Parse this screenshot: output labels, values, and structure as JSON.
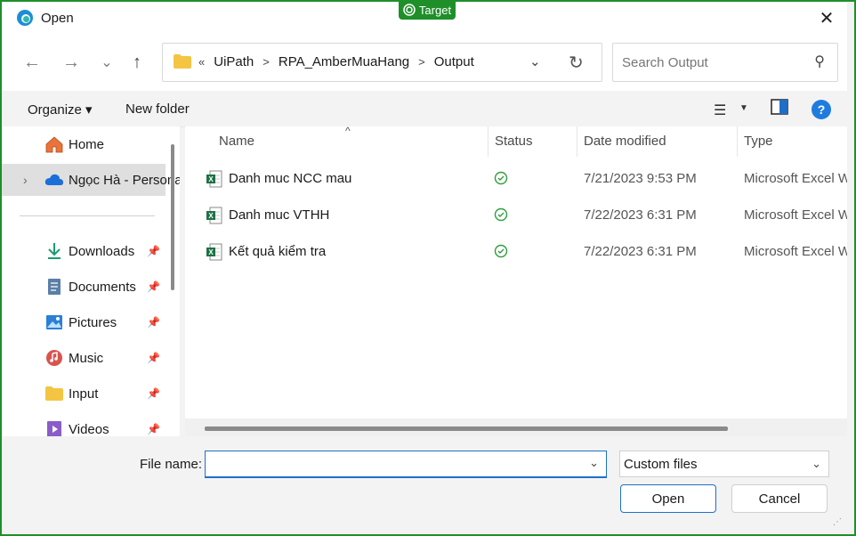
{
  "badge": {
    "label": "Target",
    "icon": "target-icon"
  },
  "window": {
    "title": "Open",
    "close_glyph": "✕"
  },
  "nav": {
    "back_glyph": "←",
    "forward_glyph": "→",
    "recent_glyph": "⌄",
    "up_glyph": "↑",
    "crumbs_prefix": "«",
    "crumbs": [
      "UiPath",
      "RPA_AmberMuaHang",
      "Output"
    ],
    "search_placeholder": "Search Output"
  },
  "commands": {
    "organize": "Organize ▾",
    "new_folder": "New folder"
  },
  "sidebar": {
    "items": [
      {
        "label": "Home",
        "icon": "home-icon"
      },
      {
        "label": "Ngọc Hà - Personal",
        "icon": "onedrive-cloud-icon",
        "selected": true
      },
      {
        "label": "Downloads",
        "icon": "download-icon",
        "pinned": true
      },
      {
        "label": "Documents",
        "icon": "documents-icon",
        "pinned": true
      },
      {
        "label": "Pictures",
        "icon": "pictures-icon",
        "pinned": true
      },
      {
        "label": "Music",
        "icon": "music-icon",
        "pinned": true
      },
      {
        "label": "Input",
        "icon": "folder-icon",
        "pinned": true
      },
      {
        "label": "Videos",
        "icon": "videos-icon",
        "pinned": true
      }
    ]
  },
  "columns": {
    "name": "Name",
    "status": "Status",
    "date": "Date modified",
    "type": "Type"
  },
  "files": [
    {
      "name": "Danh muc NCC mau",
      "status": "synced",
      "date": "7/21/2023 9:53 PM",
      "type": "Microsoft Excel Worksheet"
    },
    {
      "name": "Danh muc VTHH",
      "status": "synced",
      "date": "7/22/2023 6:31 PM",
      "type": "Microsoft Excel Worksheet"
    },
    {
      "name": "Kết quả kiểm tra",
      "status": "synced",
      "date": "7/22/2023 6:31 PM",
      "type": "Microsoft Excel Worksheet"
    }
  ],
  "bottom": {
    "filename_label": "File name:",
    "filename_value": "",
    "filter_value": "Custom files",
    "open_label": "Open",
    "cancel_label": "Cancel"
  },
  "colors": {
    "accent": "#1f6fc9",
    "badge": "#1f8f2a",
    "excel": "#1e7145",
    "status_ok": "#2e9e3e"
  }
}
